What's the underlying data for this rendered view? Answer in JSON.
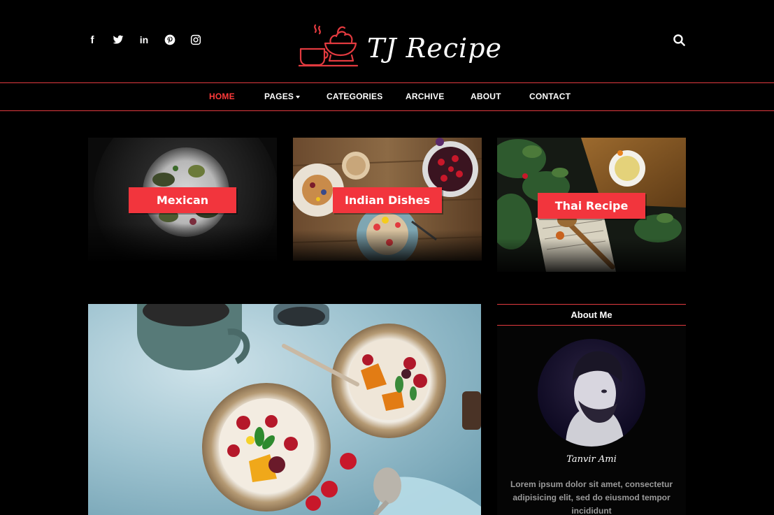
{
  "header": {
    "brand": "TJ Recipe",
    "socials": [
      {
        "icon": "facebook-icon",
        "glyph": "f"
      },
      {
        "icon": "twitter-icon"
      },
      {
        "icon": "linkedin-icon",
        "glyph": "in"
      },
      {
        "icon": "pinterest-icon"
      },
      {
        "icon": "instagram-icon"
      }
    ],
    "search_icon": "search-icon"
  },
  "nav": {
    "items": [
      {
        "label": "HOME",
        "active": true
      },
      {
        "label": "PAGES",
        "dropdown": true
      },
      {
        "label": "CATEGORIES"
      },
      {
        "label": "ARCHIVE"
      },
      {
        "label": "ABOUT"
      },
      {
        "label": "CONTACT"
      }
    ]
  },
  "categories": [
    {
      "label": "Mexican"
    },
    {
      "label": "Indian Dishes"
    },
    {
      "label": "Thai Recipe"
    }
  ],
  "sidebar": {
    "about_title": "About Me",
    "author_name": "Tanvir Ami",
    "about_text": "Lorem ipsum dolor sit amet, consectetur adipisicing elit, sed do eiusmod tempor incididunt"
  },
  "colors": {
    "accent": "#f2353d",
    "active_nav": "#ff3a3a",
    "background": "#000000"
  }
}
